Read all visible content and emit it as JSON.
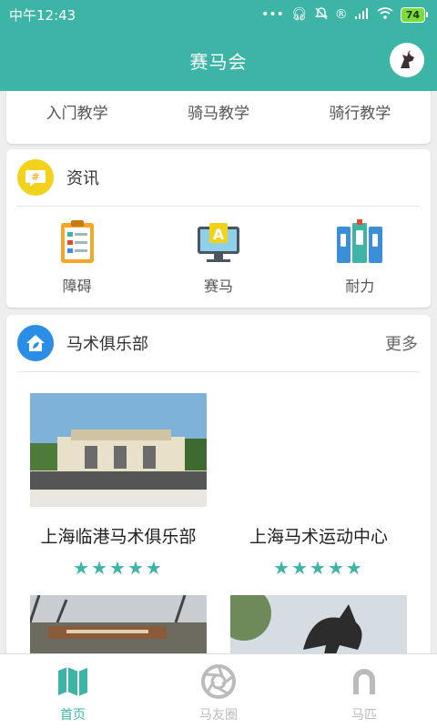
{
  "status_bar": {
    "time": "中午12:43",
    "icons": [
      "more-dots-icon",
      "headset-icon",
      "mute-bell-icon",
      "registered-icon",
      "signal-icon",
      "wifi-icon"
    ],
    "battery": "74"
  },
  "header": {
    "title": "赛马会",
    "avatar_icon": "horse-head-avatar-icon"
  },
  "tutorials": {
    "items": [
      {
        "label": "入门教学",
        "icon": "book-icon"
      },
      {
        "label": "骑马教学",
        "icon": "tablet-icon"
      },
      {
        "label": "骑行教学",
        "icon": "card-icon"
      }
    ]
  },
  "news": {
    "title": "资讯",
    "icon": "hashtag-chat-icon",
    "items": [
      {
        "label": "障碍",
        "icon": "clipboard-icon"
      },
      {
        "label": "赛马",
        "icon": "monitor-a-icon"
      },
      {
        "label": "耐力",
        "icon": "binders-icon"
      }
    ]
  },
  "clubs": {
    "title": "马术俱乐部",
    "more": "更多",
    "icon": "home-leaf-icon",
    "items": [
      {
        "name": "上海临港马术俱乐部",
        "rating": 5,
        "stars": "★★★★★"
      },
      {
        "name": "上海马术运动中心",
        "rating": 5,
        "stars": "★★★★★"
      },
      {
        "name": "",
        "rating": 0,
        "stars": ""
      },
      {
        "name": "",
        "rating": 0,
        "stars": ""
      }
    ]
  },
  "tabbar": {
    "tabs": [
      {
        "label": "首页",
        "icon": "map-icon",
        "active": true
      },
      {
        "label": "马友圈",
        "icon": "aperture-icon",
        "active": false
      },
      {
        "label": "马匹",
        "icon": "horseshoe-icon",
        "active": false
      }
    ]
  },
  "colors": {
    "primary": "#3cb4a6",
    "star": "#3cb4a6",
    "inactive": "#bbbbbb",
    "battery": "#7ddc3a"
  }
}
